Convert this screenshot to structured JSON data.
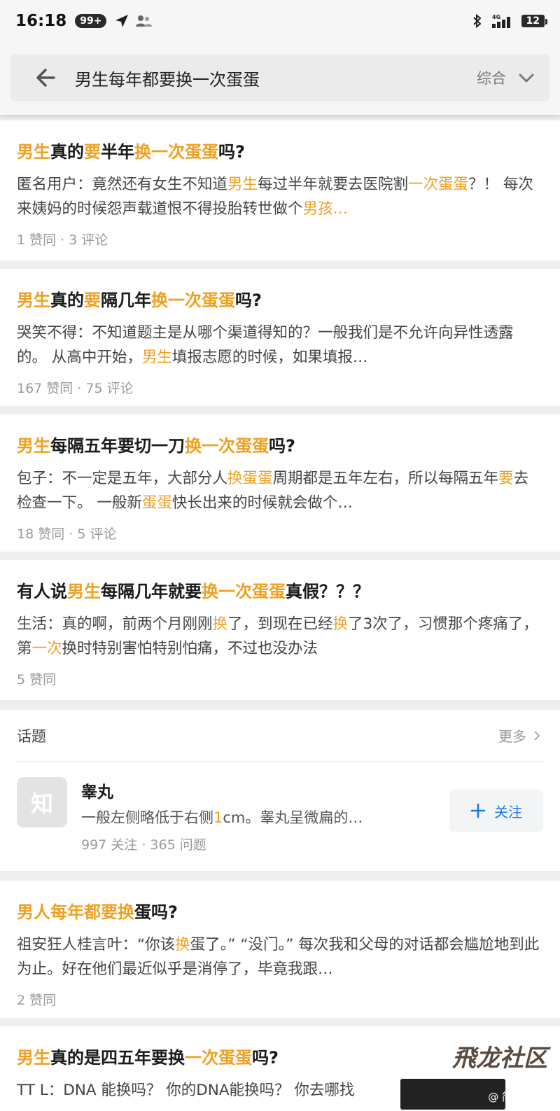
{
  "status_bar": {
    "time": "16:18",
    "badge": "99+",
    "network": "4G",
    "battery": "12"
  },
  "search": {
    "query": "男生每年都要换一次蛋蛋",
    "filter": "综合"
  },
  "results": [
    {
      "title": [
        [
          "男生",
          "h"
        ],
        [
          "真的",
          ""
        ],
        [
          "要",
          "h"
        ],
        [
          "半年",
          ""
        ],
        [
          "换一次蛋蛋",
          "h"
        ],
        [
          "吗?",
          ""
        ]
      ],
      "snippet": [
        [
          "匿名用户：竟然还有女生不知道",
          ""
        ],
        [
          "男生",
          "h"
        ],
        [
          "每过半年就要去医院割",
          ""
        ],
        [
          "一次蛋蛋",
          "h"
        ],
        [
          "？！ 每次来姨妈的时候怨声载道恨不得投胎转世做个",
          ""
        ],
        [
          "男孩…",
          "h"
        ]
      ],
      "meta": "1 赞同 · 3 评论"
    },
    {
      "title": [
        [
          "男生",
          "h"
        ],
        [
          "真的",
          ""
        ],
        [
          "要",
          "h"
        ],
        [
          "隔几年",
          ""
        ],
        [
          "换一次蛋蛋",
          "h"
        ],
        [
          "吗?",
          ""
        ]
      ],
      "snippet": [
        [
          "哭笑不得：不知道题主是从哪个渠道得知的？一般我们是不允许向异性透露的。 从高中开始，",
          ""
        ],
        [
          "男生",
          "h"
        ],
        [
          "填报志愿的时候，如果填报…",
          ""
        ]
      ],
      "meta": "167 赞同 · 75 评论"
    },
    {
      "title": [
        [
          "男生",
          "h"
        ],
        [
          "每隔五年要切一刀",
          ""
        ],
        [
          "换一次蛋蛋",
          "h"
        ],
        [
          "吗?",
          ""
        ]
      ],
      "snippet": [
        [
          "包子：不一定是五年，大部分人",
          ""
        ],
        [
          "换蛋蛋",
          "h"
        ],
        [
          "周期都是五年左右，所以每隔五年",
          ""
        ],
        [
          "要",
          "h"
        ],
        [
          "去检查一下。 一般新",
          ""
        ],
        [
          "蛋蛋",
          "h"
        ],
        [
          "快长出来的时候就会做个…",
          ""
        ]
      ],
      "meta": "18 赞同 · 5 评论"
    },
    {
      "title": [
        [
          "有人说",
          ""
        ],
        [
          "男生",
          "h"
        ],
        [
          "每隔几年就要",
          ""
        ],
        [
          "换一次蛋蛋",
          "h"
        ],
        [
          "真假？？？",
          ""
        ]
      ],
      "snippet": [
        [
          "生活：真的啊，前两个月刚刚",
          ""
        ],
        [
          "换",
          "h"
        ],
        [
          "了，到现在已经",
          ""
        ],
        [
          "换",
          "h"
        ],
        [
          "了3次了，习惯那个疼痛了，第",
          ""
        ],
        [
          "一次",
          "h"
        ],
        [
          "换时特别害怕特别怕痛，不过也没办法",
          ""
        ]
      ],
      "meta": "5 赞同"
    }
  ],
  "topic_section": {
    "label": "话题",
    "more": "更多",
    "avatar_text": "知",
    "name": "睾丸",
    "desc": [
      [
        "一般左侧略低于右侧",
        ""
      ],
      [
        "1",
        "h"
      ],
      [
        "cm。睾丸呈微扁的…",
        ""
      ]
    ],
    "meta": "997 关注 · 365 问题",
    "follow_label": "关注"
  },
  "results_bottom": [
    {
      "title": [
        [
          "男人每年都要换",
          "h"
        ],
        [
          "蛋吗?",
          ""
        ]
      ],
      "snippet": [
        [
          "祖安狂人桂言叶：“你该",
          ""
        ],
        [
          "换",
          "h"
        ],
        [
          "蛋了。” “没门。” 每次我和父母的对话都会尴尬地到此为止。好在他们最近似乎是消停了，毕竟我跟…",
          ""
        ]
      ],
      "meta": "2 赞同"
    },
    {
      "title": [
        [
          "男生",
          "h"
        ],
        [
          "真的是四五年要换",
          ""
        ],
        [
          "一次蛋蛋",
          "h"
        ],
        [
          "吗?",
          ""
        ]
      ],
      "snippet": [
        [
          "TT L：DNA 能换吗？ 你的DNA能换吗？ 你去哪找",
          ""
        ]
      ],
      "meta": ""
    }
  ],
  "watermark": {
    "title": "飛龙社区",
    "user": "@ 简鹊祥"
  },
  "colors": {
    "highlight": "#f0a020",
    "follow": "#1e78e6"
  }
}
